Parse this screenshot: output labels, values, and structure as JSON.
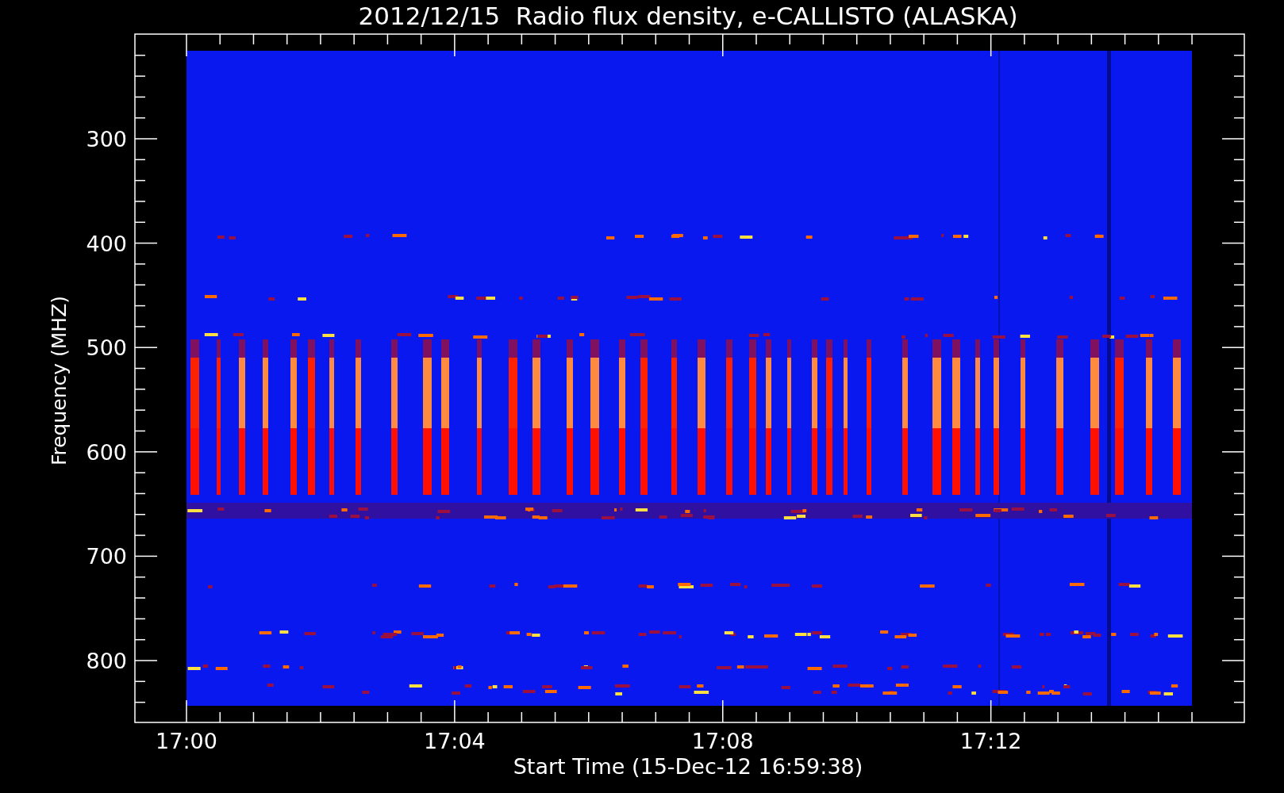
{
  "title": "2012/12/15  Radio flux density, e-CALLISTO (ALASKA)",
  "ylabel": "Frequency (MHZ)",
  "xlabel": "Start Time (15-Dec-12 16:59:38)",
  "yticks": [
    "300",
    "400",
    "500",
    "600",
    "700",
    "800"
  ],
  "xticks": [
    "17:00",
    "17:04",
    "17:08",
    "17:12"
  ]
}
